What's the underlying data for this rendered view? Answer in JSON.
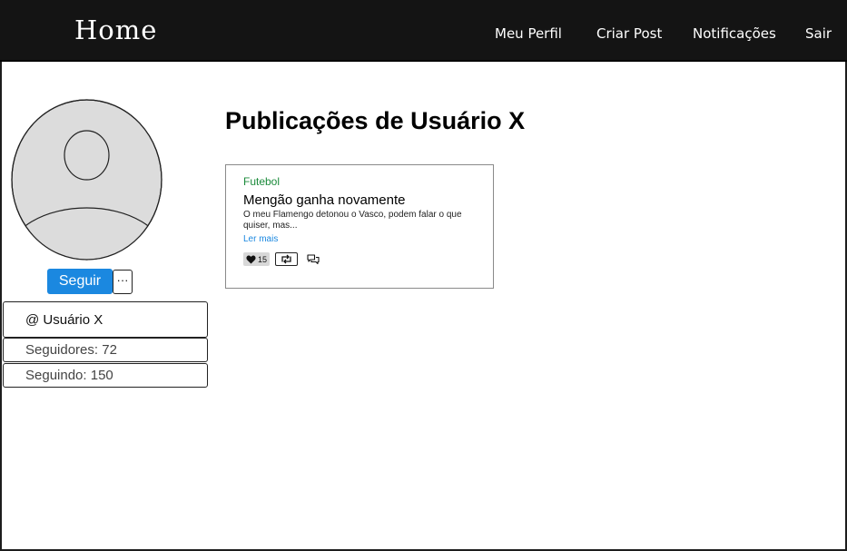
{
  "header": {
    "brand": "Home",
    "nav": [
      "Meu Perfil",
      "Criar Post",
      "Notificações",
      "Sair"
    ]
  },
  "profile": {
    "avatar_icon": "user-avatar-icon",
    "follow_label": "Seguir",
    "more_label": "···",
    "username": "@ Usuário X",
    "followers": "Seguidores: 72",
    "following": "Seguindo: 150"
  },
  "main": {
    "title": "Publicações de Usuário X",
    "posts": [
      {
        "category": "Futebol",
        "title": "Mengão ganha novamente",
        "excerpt": "O meu Flamengo detonou o Vasco, podem falar o que quiser, mas...",
        "read_more": "Ler mais",
        "likes": "15",
        "icons": [
          "heart-icon",
          "repost-icon",
          "comment-icon"
        ]
      }
    ]
  },
  "colors": {
    "header_bg": "#141414",
    "primary_button": "#1b88e0",
    "category": "#1a8a3a",
    "link": "#1b88e0",
    "avatar_fill": "#dcdcdc"
  }
}
